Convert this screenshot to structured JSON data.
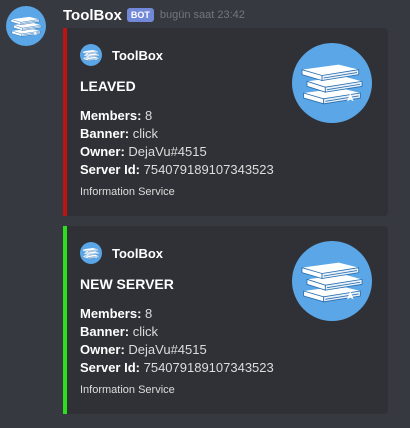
{
  "message": {
    "username": "ToolBox",
    "bot_tag": "BOT",
    "timestamp": "bugün saat 23:42"
  },
  "colors": {
    "leave_accent": "#bc1413",
    "join_accent": "#2be01b",
    "avatar_bg": "#5aa6e6"
  },
  "icon": "books-icon",
  "embeds": [
    {
      "author": "ToolBox",
      "title": "LEAVED",
      "fields": [
        {
          "name": "Members:",
          "value": "8"
        },
        {
          "name": "Banner:",
          "value": "click"
        },
        {
          "name": "Owner:",
          "value": "DejaVu#4515"
        },
        {
          "name": "Server Id:",
          "value": "754079189107343523"
        }
      ],
      "footer": "Information Service"
    },
    {
      "author": "ToolBox",
      "title": "NEW SERVER",
      "fields": [
        {
          "name": "Members:",
          "value": "8"
        },
        {
          "name": "Banner:",
          "value": "click"
        },
        {
          "name": "Owner:",
          "value": "DejaVu#4515"
        },
        {
          "name": "Server Id:",
          "value": "754079189107343523"
        }
      ],
      "footer": "Information Service"
    }
  ]
}
